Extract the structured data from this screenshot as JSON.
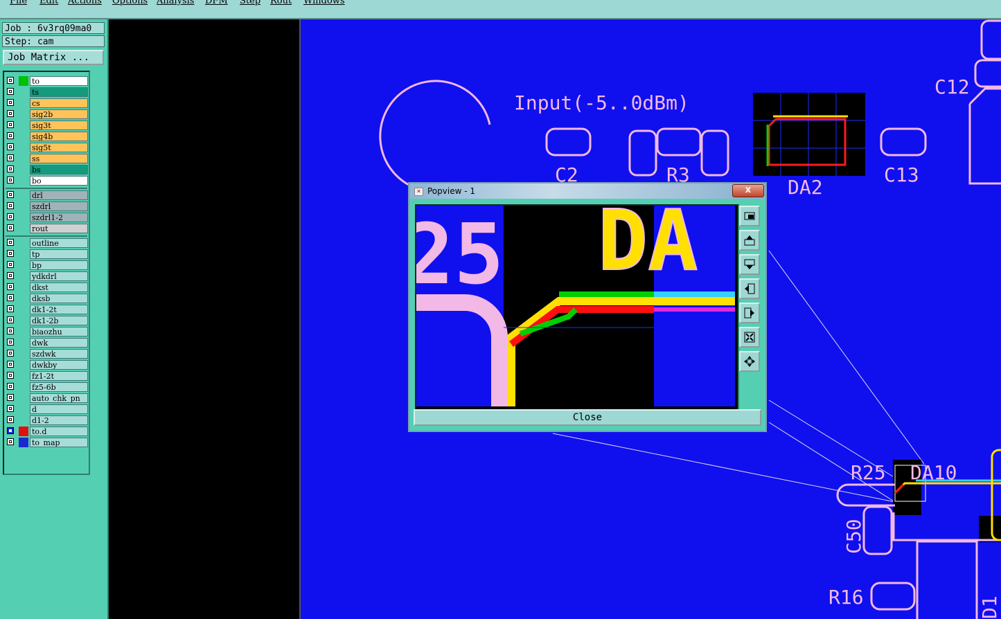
{
  "menu": [
    "File",
    "Edit",
    "Actions",
    "Options",
    "Analysis",
    "DFM",
    "Step",
    "Rout",
    "Windows"
  ],
  "job": {
    "label": "Job : 6v3rq09ma0",
    "step": "Step: cam",
    "matrix_button": "Job Matrix ..."
  },
  "layers": {
    "group1": [
      {
        "name": "to",
        "color": "#00c000",
        "bg": "#ffffff",
        "checked": false
      },
      {
        "name": "ts",
        "color": "",
        "bg": "#159a7e",
        "checked": false
      },
      {
        "name": "cs",
        "color": "",
        "bg": "#ffc35a",
        "checked": false
      },
      {
        "name": "sig2b",
        "color": "",
        "bg": "#ffc35a",
        "checked": false
      },
      {
        "name": "sig3t",
        "color": "",
        "bg": "#ffc35a",
        "checked": false
      },
      {
        "name": "sig4b",
        "color": "",
        "bg": "#ffc35a",
        "checked": false
      },
      {
        "name": "sig5t",
        "color": "",
        "bg": "#ffc35a",
        "checked": false
      },
      {
        "name": "ss",
        "color": "",
        "bg": "#ffc35a",
        "checked": false
      },
      {
        "name": "bs",
        "color": "",
        "bg": "#159a7e",
        "checked": false
      },
      {
        "name": "bo",
        "color": "",
        "bg": "#ffffff",
        "checked": false
      }
    ],
    "group2": [
      {
        "name": "drl",
        "color": "",
        "bg": "#9fb3b8",
        "checked": false
      },
      {
        "name": "szdrl",
        "color": "",
        "bg": "#9fb3b8",
        "checked": false
      },
      {
        "name": "szdrl1-2",
        "color": "",
        "bg": "#9fb3b8",
        "checked": false
      },
      {
        "name": "rout",
        "color": "",
        "bg": "#d0d0d0",
        "checked": false
      }
    ],
    "group3": [
      {
        "name": "outline",
        "color": "",
        "bg": "#a7ddd8",
        "checked": false
      },
      {
        "name": "tp",
        "color": "",
        "bg": "#a7ddd8",
        "checked": false
      },
      {
        "name": "bp",
        "color": "",
        "bg": "#a7ddd8",
        "checked": false
      },
      {
        "name": "ydkdrl",
        "color": "",
        "bg": "#a7ddd8",
        "checked": false
      },
      {
        "name": "dkst",
        "color": "",
        "bg": "#a7ddd8",
        "checked": false
      },
      {
        "name": "dksb",
        "color": "",
        "bg": "#a7ddd8",
        "checked": false
      },
      {
        "name": "dk1-2t",
        "color": "",
        "bg": "#a7ddd8",
        "checked": false
      },
      {
        "name": "dk1-2b",
        "color": "",
        "bg": "#a7ddd8",
        "checked": false
      },
      {
        "name": "biaozhu",
        "color": "",
        "bg": "#a7ddd8",
        "checked": false
      },
      {
        "name": "dwk",
        "color": "",
        "bg": "#a7ddd8",
        "checked": false
      },
      {
        "name": "szdwk",
        "color": "",
        "bg": "#a7ddd8",
        "checked": false
      },
      {
        "name": "dwkby",
        "color": "",
        "bg": "#a7ddd8",
        "checked": false
      },
      {
        "name": "fz1-2t",
        "color": "",
        "bg": "#a7ddd8",
        "checked": false
      },
      {
        "name": "fz5-6b",
        "color": "",
        "bg": "#a7ddd8",
        "checked": false
      },
      {
        "name": "auto_chk_pn",
        "color": "",
        "bg": "#a7ddd8",
        "checked": false
      },
      {
        "name": "d",
        "color": "",
        "bg": "#a7ddd8",
        "checked": false
      },
      {
        "name": "d1-2",
        "color": "",
        "bg": "#a7ddd8",
        "checked": false
      },
      {
        "name": "to.d",
        "color": "#e01010",
        "bg": "#a7ddd8",
        "checked": true
      },
      {
        "name": "to_map",
        "color": "#1a2ad0",
        "bg": "#a7ddd8",
        "checked": false
      }
    ]
  },
  "pcb_labels": {
    "input": "Input(-5..0dBm)",
    "c2": "C2",
    "r3": "R3",
    "da2": "DA2",
    "c13": "C13",
    "c12": "C12",
    "r25": "R25",
    "da10": "DA10",
    "c50": "C50",
    "r16": "R16",
    "d1": "D1"
  },
  "popview": {
    "title": "Popview - 1",
    "close_x": "x",
    "close_button": "Close",
    "zoom_labels": {
      "left": "25",
      "right": "DA"
    },
    "tools": [
      "zoom-fit-icon",
      "move-up-icon",
      "move-down-icon",
      "move-left-icon",
      "move-right-icon",
      "zoom-in-icon",
      "pan-icon"
    ]
  },
  "colors": {
    "canvas": "#1010ee",
    "silkscreen": "#f2b8e6",
    "panel": "#55cfb2",
    "highlight_yellow": "#ffe000",
    "trace_red": "#ff1010",
    "trace_green": "#00d000",
    "trace_cyan": "#34d2ff"
  }
}
